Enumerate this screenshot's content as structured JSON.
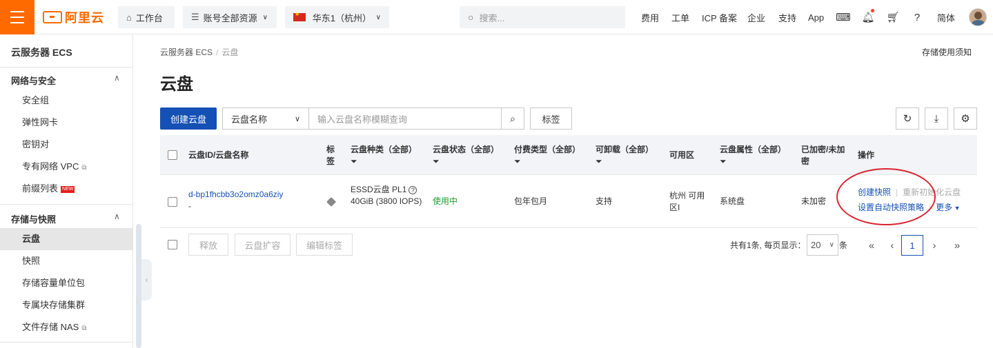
{
  "topbar": {
    "brand": "阿里云",
    "workbench": "工作台",
    "resources": "账号全部资源",
    "region": "华东1（杭州）",
    "search_placeholder": "搜索...",
    "links": [
      "费用",
      "工单",
      "ICP 备案",
      "企业",
      "支持",
      "App"
    ],
    "lang": "简体",
    "accent_color": "#ff6a00"
  },
  "sidebar": {
    "title": "云服务器 ECS",
    "group1": "网络与安全",
    "group1_items": [
      "安全组",
      "弹性网卡",
      "密钥对",
      "专有网络 VPC",
      "前缀列表"
    ],
    "new_badge": "NEW",
    "group2": "存储与快照",
    "group2_items": [
      "云盘",
      "快照",
      "存储容量单位包",
      "专属块存储集群",
      "文件存储 NAS"
    ]
  },
  "main": {
    "breadcrumb": [
      "云服务器 ECS",
      "云盘"
    ],
    "notice": "存储使用须知",
    "title": "云盘",
    "create_btn": "创建云盘",
    "search_field": "云盘名称",
    "search_placeholder": "输入云盘名称模糊查询",
    "tag_btn": "标签"
  },
  "table": {
    "headers": {
      "id": "云盘ID/云盘名称",
      "tag": "标签",
      "type": "云盘种类（全部）",
      "status": "云盘状态（全部）",
      "billing": "付费类型（全部）",
      "detachable": "可卸载（全部）",
      "zone": "可用区",
      "attr": "云盘属性（全部）",
      "encrypt": "已加密/未加密",
      "ops": "操作"
    },
    "row": {
      "id": "d-bp1fhcbb3o2omz0a6ziy",
      "name": "-",
      "type": "ESSD云盘  PL1",
      "size": "40GiB (3800 IOPS)",
      "status": "使用中",
      "billing": "包年包月",
      "detachable": "支持",
      "zone": "杭州 可用区I",
      "attr": "系统盘",
      "encrypt": "未加密",
      "op_snapshot": "创建快照",
      "op_reinit": "重新初始化云盘",
      "op_autosnap": "设置自动快照策略",
      "op_more": "更多"
    }
  },
  "footer": {
    "release": "释放",
    "expand": "云盘扩容",
    "edit_tags": "编辑标签",
    "total": "共有1条, 每页显示：",
    "page_size": "20",
    "unit": "条",
    "current_page": "1"
  }
}
